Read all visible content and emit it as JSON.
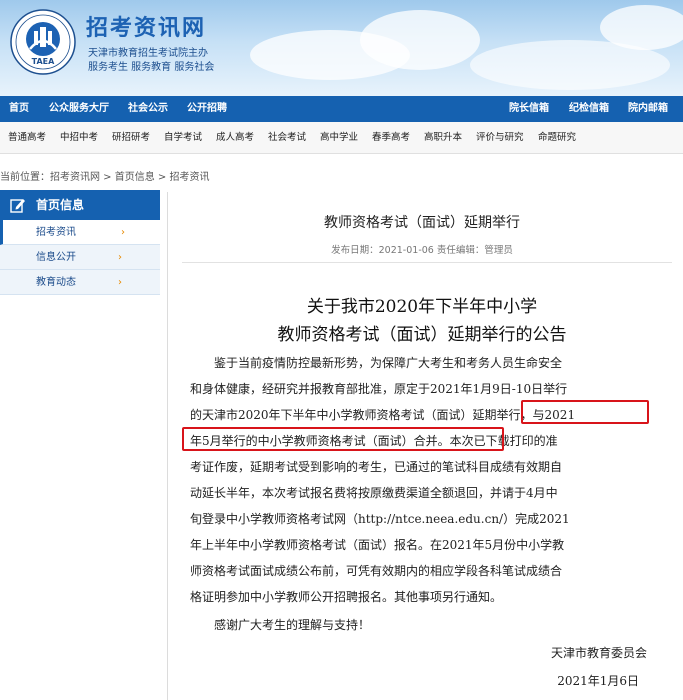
{
  "header": {
    "site_title": "招考资讯网",
    "subtitle_1": "天津市教育招生考试院主办",
    "subtitle_2": "服务考生 服务教育 服务社会",
    "logo_text": "TAEA"
  },
  "nav": {
    "left_items": [
      "首页",
      "公众服务大厅",
      "社会公示",
      "公开招聘"
    ],
    "right_items": [
      "院长信箱",
      "纪检信箱",
      "院内邮箱"
    ]
  },
  "subnav": {
    "items": [
      "普通高考",
      "中招中考",
      "研招研考",
      "自学考试",
      "成人高考",
      "社会考试",
      "高中学业",
      "春季高考",
      "高职升本",
      "评价与研究",
      "命题研究"
    ]
  },
  "breadcrumb": "当前位置：招考资讯网 > 首页信息 > 招考资讯",
  "sidebar": {
    "heading": "首页信息",
    "items": [
      {
        "label": "招考资讯",
        "active": true
      },
      {
        "label": "信息公开",
        "active": false
      },
      {
        "label": "教育动态",
        "active": false
      }
    ],
    "chevron": "›"
  },
  "article": {
    "title": "教师资格考试（面试）延期举行",
    "meta": "发布日期：2021-01-06    责任编辑：管理员",
    "notice_title_1": "关于我市2020年下半年中小学",
    "notice_title_2": "教师资格考试（面试）延期举行的公告",
    "lines": [
      "　　鉴于当前疫情防控最新形势，为保障广大考生和考务人员生命安全",
      "和身体健康，经研究并报教育部批准，原定于2021年1月9日-10日举行",
      "的天津市2020年下半年中小学教师资格考试（面试）延期举行，与2021",
      "年5月举行的中小学教师资格考试（面试）合并。本次已下载打印的准",
      "考证作废，延期考试受到影响的考生，已通过的笔试科目成绩有效期自",
      "动延长半年，本次考试报名费将按原缴费渠道全额退回，并请于4月中",
      "旬登录中小学教师资格考试网（http://ntce.neea.edu.cn/）完成2021",
      "年上半年中小学教师资格考试（面试）报名。在2021年5月份中小学教",
      "师资格考试面试成绩公布前，可凭有效期内的相应学段各科笔试成绩合",
      "格证明参加中小学教师公开招聘报名。其他事项另行通知。",
      "　　感谢广大考生的理解与支持！"
    ],
    "signature": "天津市教育委员会",
    "date": "2021年1月6日"
  },
  "colors": {
    "nav_blue": "#1561b0",
    "highlight_red": "#d8141a",
    "chevron_orange": "#e88a00"
  }
}
